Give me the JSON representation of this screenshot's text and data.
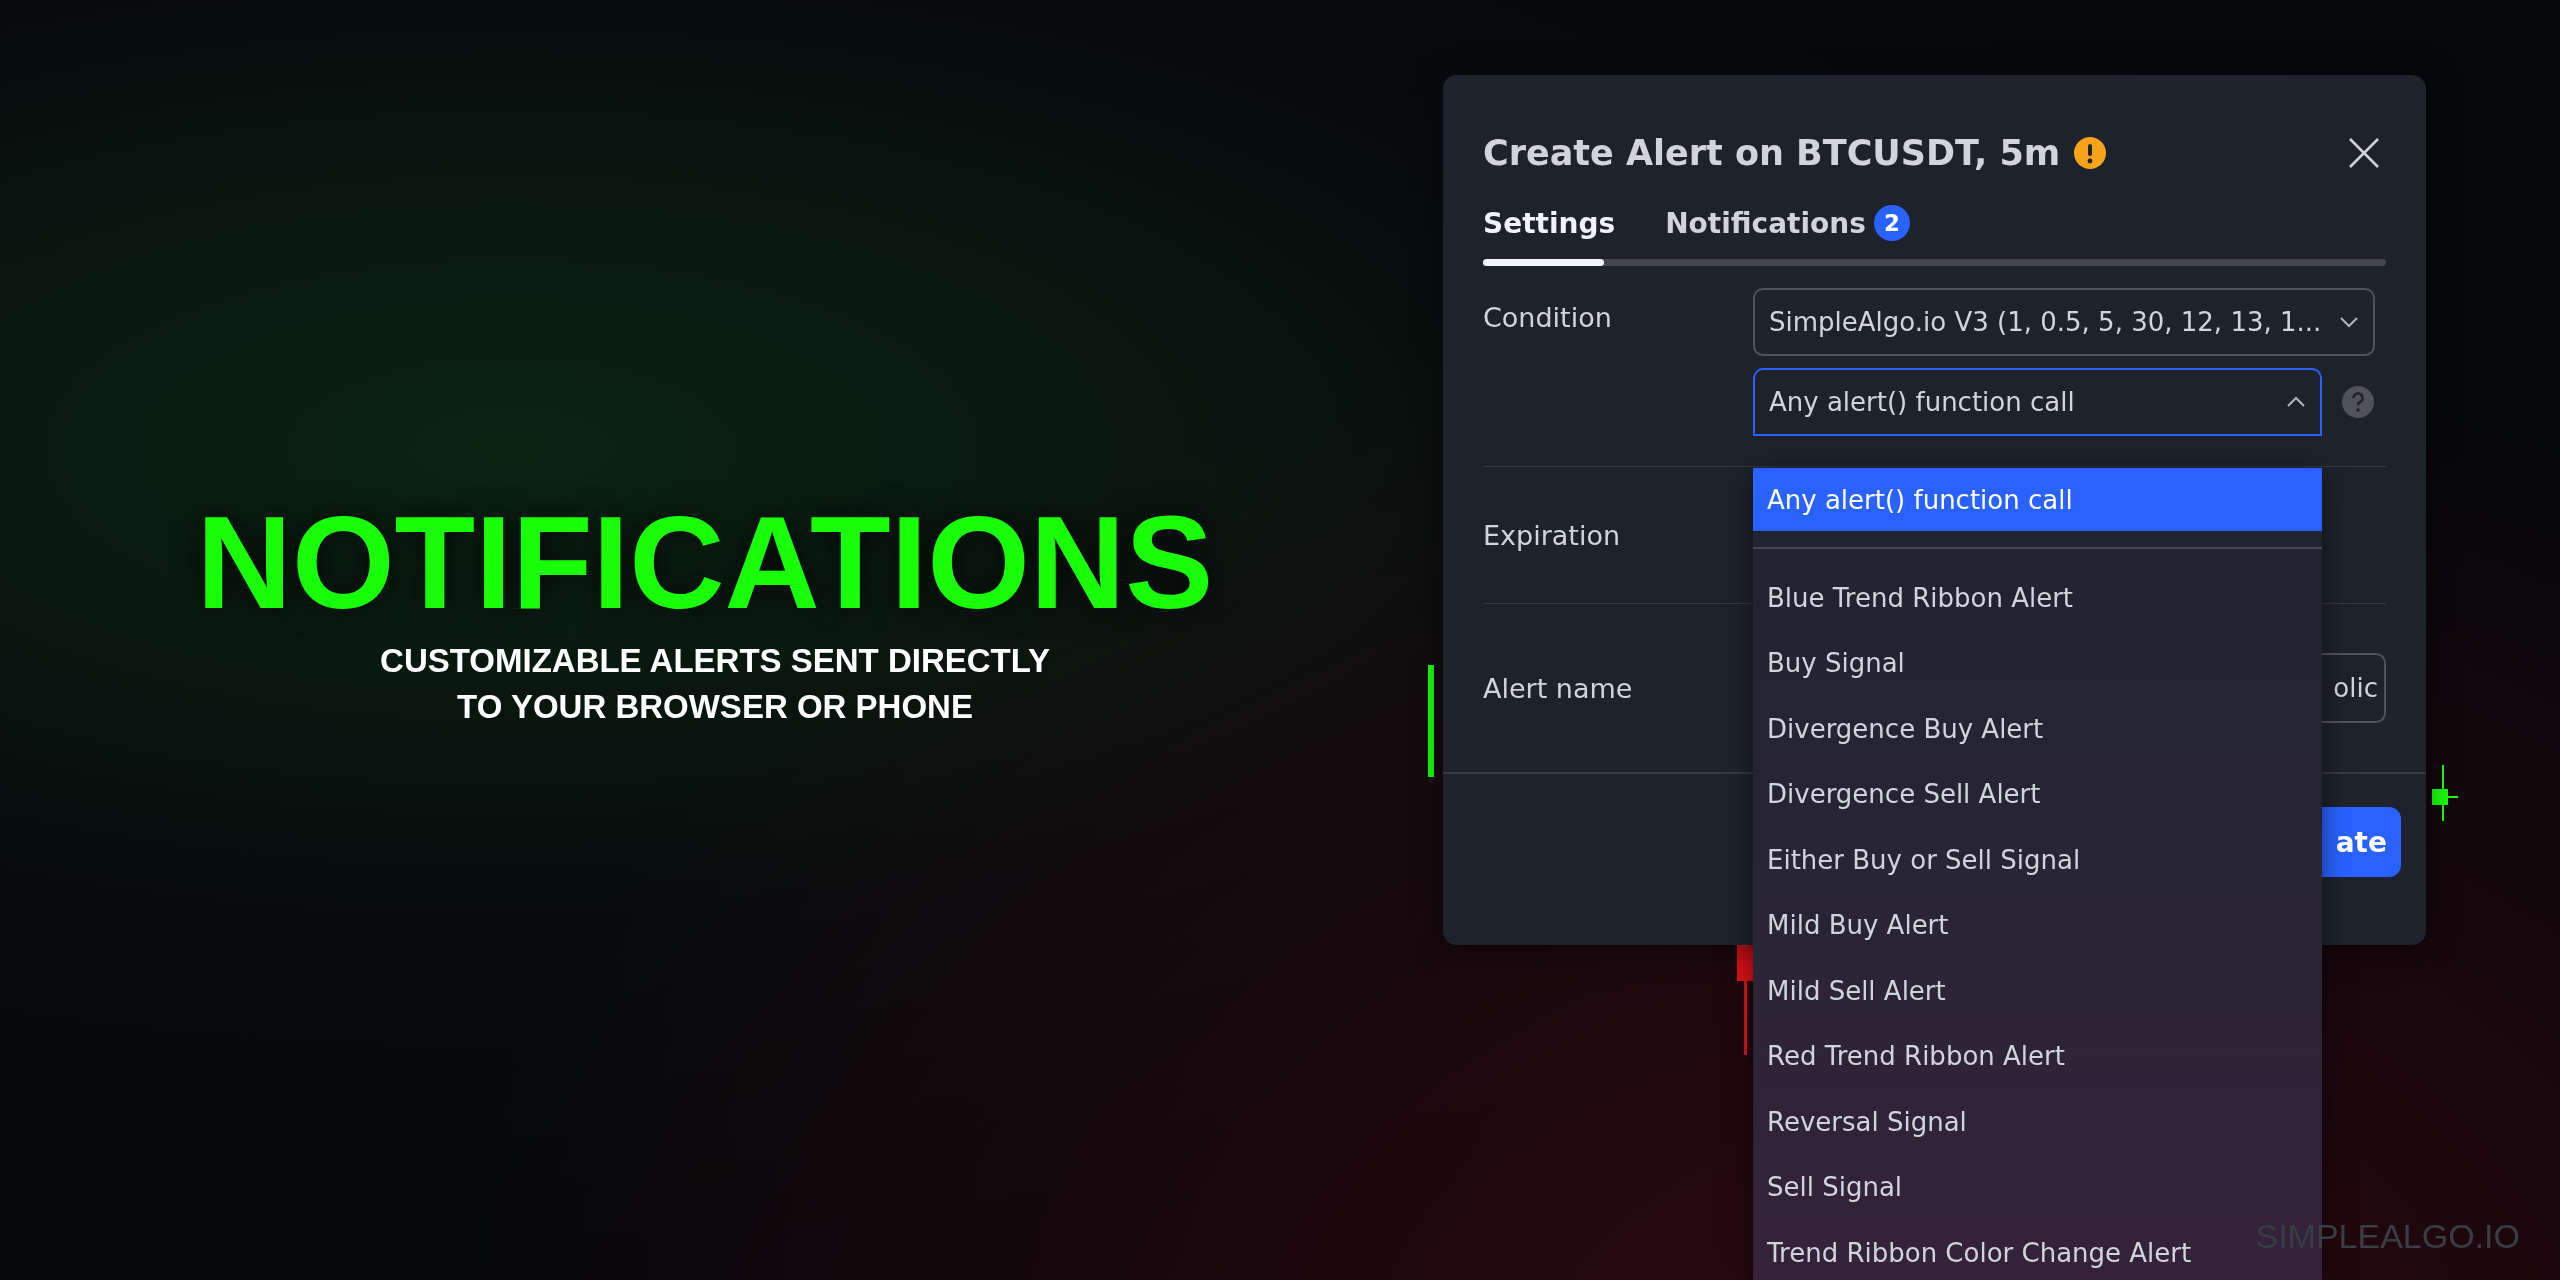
{
  "banner": {
    "headline": "NOTIFICATIONS",
    "subtitle_lines": [
      "CUSTOMIZABLE ALERTS SENT DIRECTLY",
      "TO YOUR BROWSER OR PHONE"
    ]
  },
  "dialog": {
    "title": "Create Alert on BTCUSDT, 5m",
    "tabs": [
      {
        "label": "Settings",
        "selected": true
      },
      {
        "label": "Notifications",
        "selected": false,
        "badge": "2"
      }
    ],
    "condition": {
      "label": "Condition",
      "selects": [
        {
          "value": "SimpleAlgo.io V3 (1, 0.5, 5, 30, 12, 13, 1...",
          "expanded": false
        },
        {
          "value": "Any alert() function call",
          "expanded": true
        }
      ]
    },
    "dropdown": {
      "groups": [
        {
          "items": [
            {
              "label": "Any alert() function call",
              "selected": true
            }
          ]
        },
        {
          "items": [
            {
              "label": "Blue Trend Ribbon Alert",
              "selected": false
            },
            {
              "label": "Buy Signal",
              "selected": false
            },
            {
              "label": "Divergence Buy Alert",
              "selected": false
            },
            {
              "label": "Divergence Sell Alert",
              "selected": false
            },
            {
              "label": "Either Buy or Sell Signal",
              "selected": false
            },
            {
              "label": "Mild Buy Alert",
              "selected": false
            },
            {
              "label": "Mild Sell Alert",
              "selected": false
            },
            {
              "label": "Red Trend Ribbon Alert",
              "selected": false
            },
            {
              "label": "Reversal Signal",
              "selected": false
            },
            {
              "label": "Sell Signal",
              "selected": false
            },
            {
              "label": "Trend Ribbon Color Change Alert",
              "selected": false
            }
          ]
        }
      ]
    },
    "expiration": {
      "label": "Expiration"
    },
    "alert_name": {
      "label": "Alert name",
      "value": "olic"
    },
    "primary_button": "ate"
  },
  "brand": "SIMPLEALGO.IO"
}
